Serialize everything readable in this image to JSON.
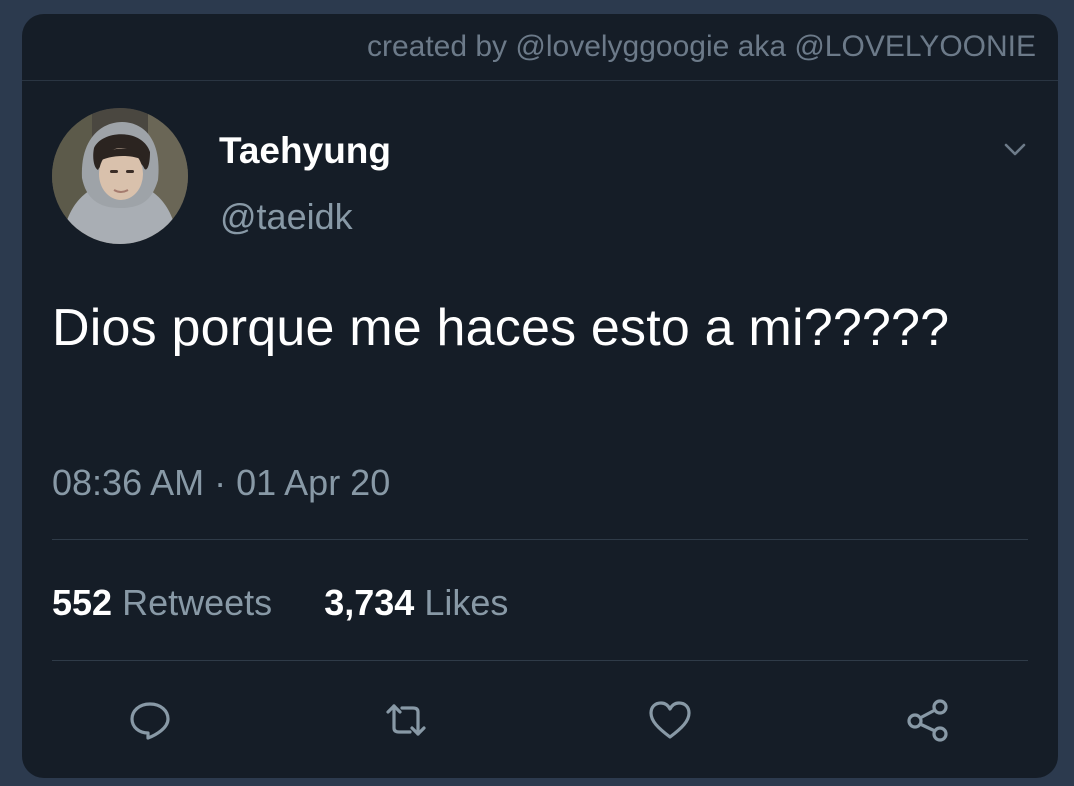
{
  "credit": {
    "text": "created by @lovelyggoogie aka @LOVELYOONIE"
  },
  "user": {
    "display_name": "Taehyung",
    "handle": "@taeidk",
    "avatar_icon": "user-avatar-photo"
  },
  "tweet": {
    "text": "Dios porque me haces esto a mi?????",
    "timestamp": "08:36 AM · 01 Apr 20"
  },
  "stats": {
    "retweets_count": "552",
    "retweets_label": "Retweets",
    "likes_count": "3,734",
    "likes_label": "Likes"
  },
  "actions": {
    "reply_icon": "reply-icon",
    "retweet_icon": "retweet-icon",
    "like_icon": "heart-icon",
    "share_icon": "share-icon",
    "more_icon": "chevron-down-icon"
  },
  "colors": {
    "page_background": "#2c3a4e",
    "card_background": "#151d27",
    "primary_text": "#ffffff",
    "secondary_text": "#8899a6"
  }
}
